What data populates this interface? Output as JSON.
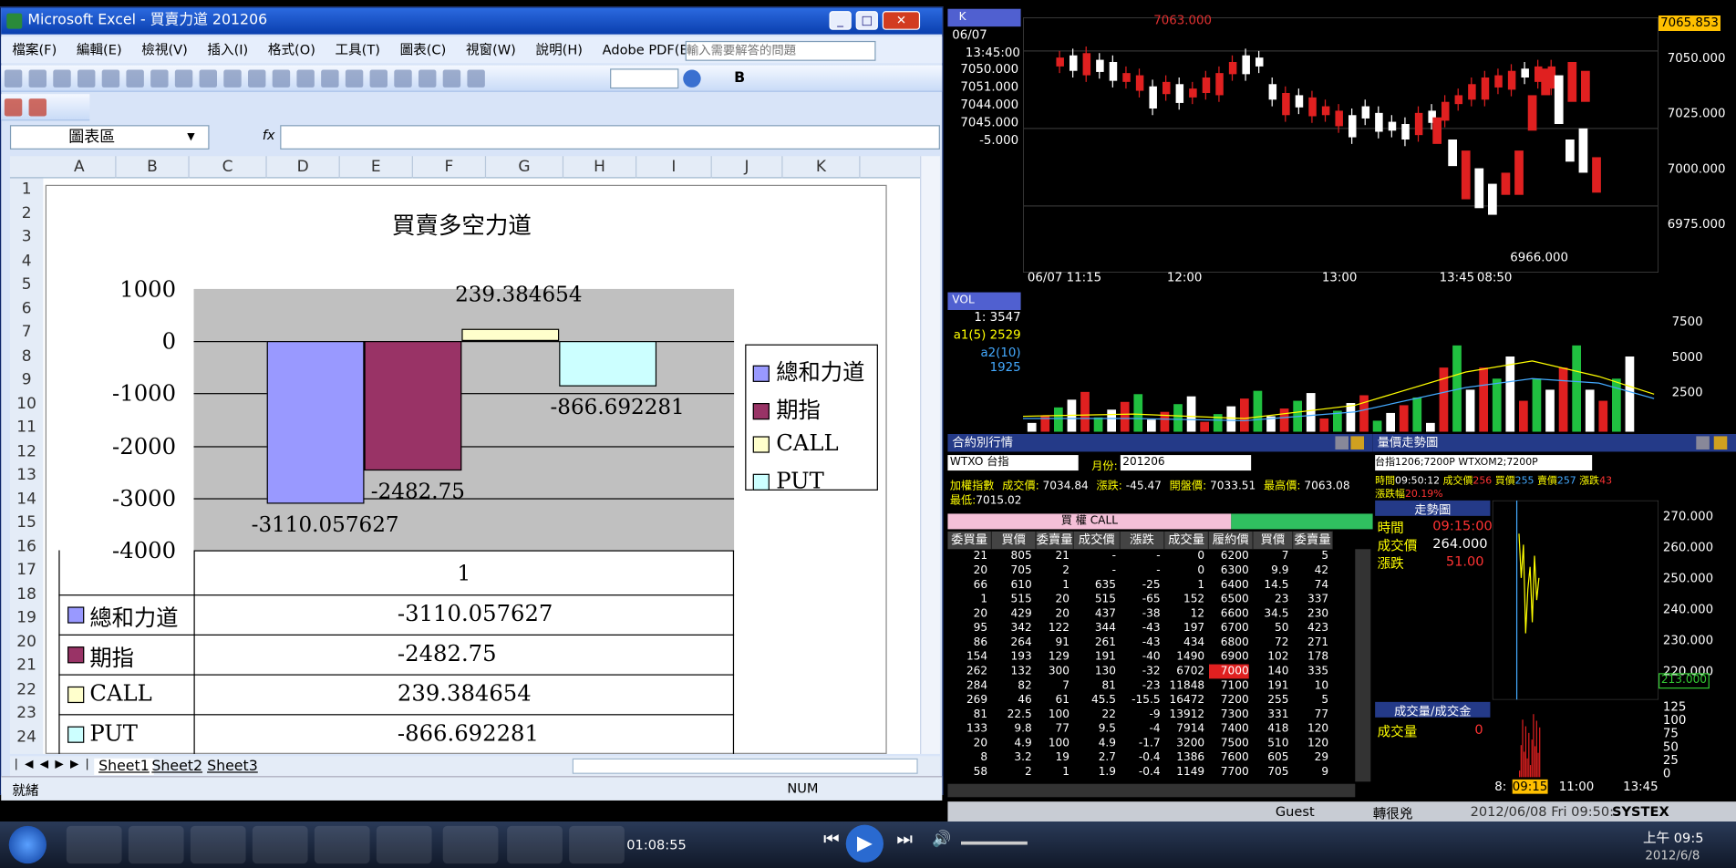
{
  "excel": {
    "title": "Microsoft Excel - 買賣力道 201206",
    "menu": [
      "檔案(F)",
      "編輯(E)",
      "檢視(V)",
      "插入(I)",
      "格式(O)",
      "工具(T)",
      "圖表(C)",
      "視窗(W)",
      "說明(H)",
      "Adobe PDF(B)"
    ],
    "help_placeholder": "輸入需要解答的問題",
    "name_box": "圖表區",
    "fx_label": "fx",
    "columns": [
      "A",
      "B",
      "C",
      "D",
      "E",
      "F",
      "G",
      "H",
      "I",
      "J",
      "K"
    ],
    "rows": [
      "1",
      "2",
      "3",
      "4",
      "5",
      "6",
      "7",
      "8",
      "9",
      "10",
      "11",
      "12",
      "13",
      "14",
      "15",
      "16",
      "17",
      "18",
      "19",
      "20",
      "21",
      "22",
      "23",
      "24"
    ],
    "sheets": [
      "Sheet1",
      "Sheet2",
      "Sheet3"
    ],
    "status_ready": "就緒",
    "status_num": "NUM"
  },
  "chart_data": {
    "type": "bar",
    "title": "買賣多空力道",
    "categories": [
      "1"
    ],
    "series": [
      {
        "name": "總和力道",
        "values": [
          -3110.057627
        ],
        "label": "-3110.057627",
        "color": "#9999ff"
      },
      {
        "name": "期指",
        "values": [
          -2482.75
        ],
        "label": "-2482.75",
        "color": "#993366"
      },
      {
        "name": "CALL",
        "values": [
          239.384654
        ],
        "label": "239.384654",
        "color": "#ffffcc"
      },
      {
        "name": "PUT",
        "values": [
          -866.692281
        ],
        "label": "-866.692281",
        "color": "#ccffff"
      }
    ],
    "yticks": [
      "1000",
      "0",
      "-1000",
      "-2000",
      "-3000",
      "-4000"
    ],
    "ylim": [
      -4000,
      1000
    ],
    "grid": true,
    "legend": "right",
    "data_table": true,
    "plot_bg": "#c0c0c0"
  },
  "kline": {
    "tag": "K",
    "date": "06/07",
    "time": "13:45:00",
    "left_vals": [
      "7050.000",
      "7051.000",
      "7044.000",
      "7045.000",
      "-5.000"
    ],
    "top_label": "7063.000",
    "low_label": "6966.000",
    "price_tag": "7065.853",
    "yticks": [
      "7050.000",
      "7025.000",
      "7000.000",
      "6975.000"
    ],
    "xticks": [
      "06/07 11:15",
      "12:00",
      "13:00",
      "13:45",
      "08:50"
    ]
  },
  "vol": {
    "tag": "VOL",
    "left_vals": [
      "3547",
      "2529",
      "1925"
    ],
    "left_labels": [
      "1:",
      "a1(5)",
      "a2(10)"
    ],
    "yticks": [
      "7500",
      "5000",
      "2500"
    ]
  },
  "options": {
    "title": "合約別行情",
    "product": "WTXO 台指",
    "month_label": "月份:",
    "month": "201206",
    "index_label": "加權指數",
    "last_label": "成交價:",
    "last": "7034.84",
    "chg_label": "漲跌:",
    "chg": "-45.47",
    "open_label": "開盤價:",
    "open": "7033.51",
    "high_label": "最高價:",
    "high": "7063.08",
    "low_label": "最低:",
    "low": "7015.02",
    "call_label": "買 權 CALL",
    "headers": [
      "委買量",
      "買價",
      "委賣量",
      "成交價",
      "漲跌",
      "成交量",
      "履約價",
      "買價",
      "委賣量"
    ],
    "rows": [
      [
        "21",
        "805",
        "21",
        "-",
        "-",
        "0",
        "6200",
        "7",
        "5"
      ],
      [
        "20",
        "705",
        "2",
        "-",
        "-",
        "0",
        "6300",
        "9.9",
        "42"
      ],
      [
        "66",
        "610",
        "1",
        "635",
        "-25",
        "1",
        "6400",
        "14.5",
        "74"
      ],
      [
        "1",
        "515",
        "20",
        "515",
        "-65",
        "152",
        "6500",
        "23",
        "337"
      ],
      [
        "20",
        "429",
        "20",
        "437",
        "-38",
        "12",
        "6600",
        "34.5",
        "230"
      ],
      [
        "95",
        "342",
        "122",
        "344",
        "-43",
        "197",
        "6700",
        "50",
        "423"
      ],
      [
        "86",
        "264",
        "91",
        "261",
        "-43",
        "434",
        "6800",
        "72",
        "271"
      ],
      [
        "154",
        "193",
        "129",
        "191",
        "-40",
        "1490",
        "6900",
        "102",
        "178"
      ],
      [
        "262",
        "132",
        "300",
        "130",
        "-32",
        "6702",
        "7000",
        "140",
        "335"
      ],
      [
        "284",
        "82",
        "7",
        "81",
        "-23",
        "11848",
        "7100",
        "191",
        "10"
      ],
      [
        "269",
        "46",
        "61",
        "45.5",
        "-15.5",
        "16472",
        "7200",
        "255",
        "5"
      ],
      [
        "81",
        "22.5",
        "100",
        "22",
        "-9",
        "13912",
        "7300",
        "331",
        "77"
      ],
      [
        "133",
        "9.8",
        "77",
        "9.5",
        "-4",
        "7914",
        "7400",
        "418",
        "120"
      ],
      [
        "20",
        "4.9",
        "100",
        "4.9",
        "-1.7",
        "3200",
        "7500",
        "510",
        "120"
      ],
      [
        "8",
        "3.2",
        "19",
        "2.7",
        "-0.4",
        "1386",
        "7600",
        "605",
        "29"
      ],
      [
        "58",
        "2",
        "1",
        "1.9",
        "-0.4",
        "1149",
        "7700",
        "705",
        "9"
      ]
    ]
  },
  "trend": {
    "title": "量價走勢圖",
    "contract1": "台指1206;7200P",
    "contract2": "WTXOM2;7200P",
    "time_label": "時間",
    "time_val": "09:50:12",
    "last_label": "成交價",
    "last_val": "256",
    "bid_label": "買價",
    "bid": "255",
    "ask_label": "賣價",
    "ask": "257",
    "chg_label": "漲跌",
    "chg": "43",
    "pct_label": "漲跌幅",
    "pct": "20.19%",
    "box_title": "走勢圖",
    "row_time": "時間",
    "row_time_v": "09:15:00",
    "row_px": "成交價",
    "row_px_v": "264.000",
    "row_chg": "漲跌",
    "row_chg_v": "51.00",
    "yticks": [
      "270.000",
      "260.000",
      "250.000",
      "240.000",
      "230.000",
      "220.000"
    ],
    "price_tag": "213.000",
    "vol_title": "成交量/成交金",
    "vol_label": "成交量",
    "vol_val": "0",
    "vol_yticks": [
      "125",
      "100",
      "75",
      "50",
      "25",
      "0"
    ],
    "xticks": [
      "8:",
      "09:15",
      "11:00",
      "13:45"
    ]
  },
  "statusbar": {
    "user": "Guest",
    "sub": "轉很兇",
    "datetime": "2012/06/08 Fri 09:50:",
    "brand": "SYSTEX"
  },
  "taskbar": {
    "media_time": "01:08:55",
    "clock": "上午 09:5",
    "date": "2012/6/8"
  }
}
